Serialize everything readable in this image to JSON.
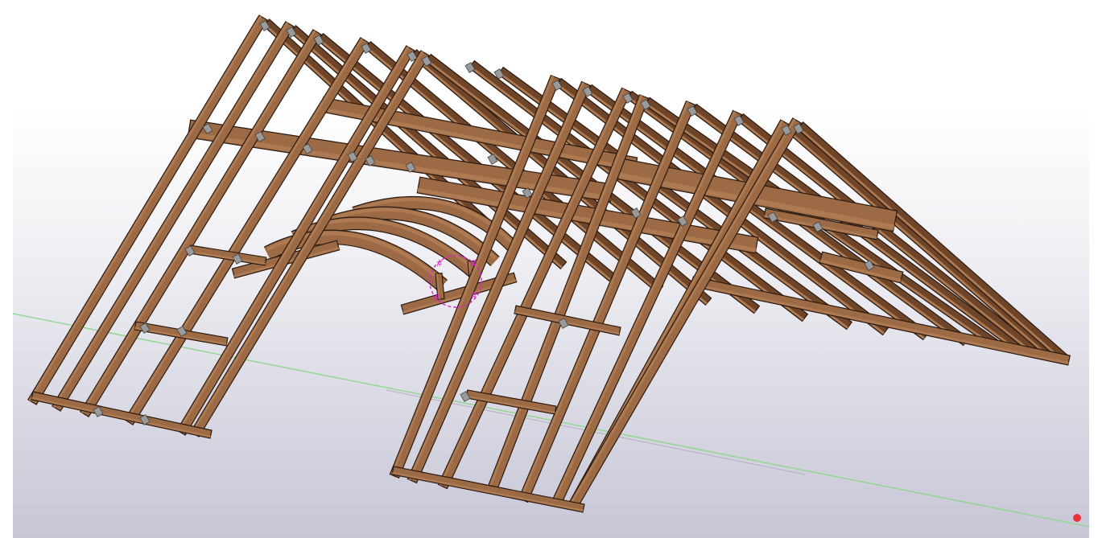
{
  "viewport": {
    "label": "3D model view",
    "background_top": "#ffffff",
    "background_mid": "#f1f1f5",
    "background_bottom": "#c7c6d6"
  },
  "model": {
    "type": "timber roof truss frame with dormer opening",
    "timber_color": "#9c6a45",
    "timber_light": "#ad7a52",
    "timber_dark": "#6e4529",
    "outline_color": "#2a1a10",
    "connector_color": "#9a9a9a",
    "selection_color": "#e020d0",
    "grid_line_color": "#8fd68f"
  },
  "icons": {
    "origin_marker": "red-dot-icon",
    "selection_marker": "dashed-circle-icon"
  }
}
